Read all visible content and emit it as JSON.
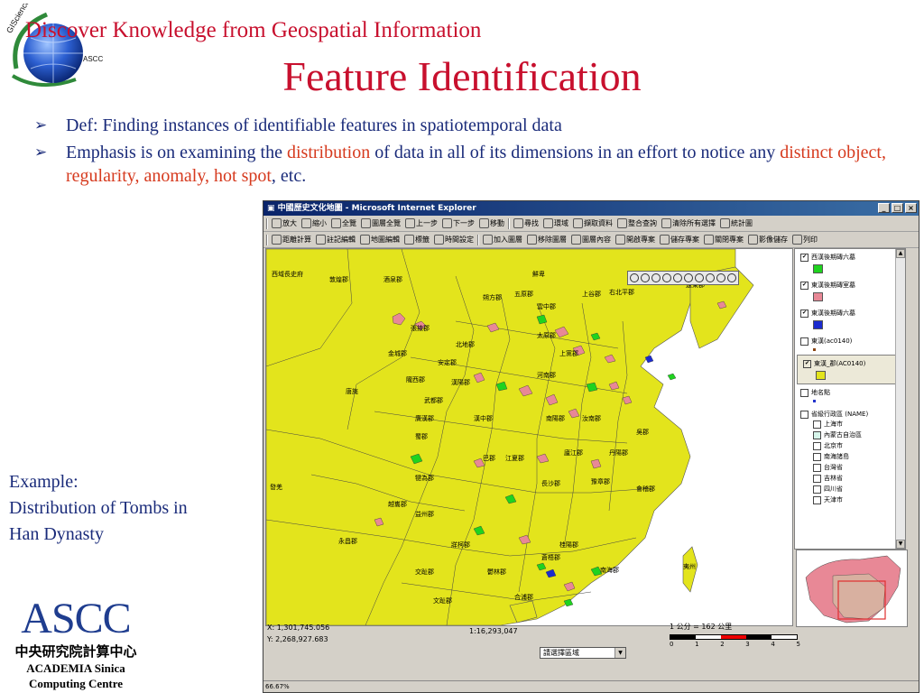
{
  "slide": {
    "tagline": "Discover Knowledge from Geospatial Information",
    "title": "Feature Identification",
    "bullets": {
      "b1_text": "Def: Finding instances of identifiable features in spatiotemporal data",
      "b2_part1": "Emphasis is on examining the ",
      "b2_hl1": "distribution",
      "b2_part2": " of data in all of its dimensions in an effort to notice any ",
      "b2_hl2": "distinct object, regularity, anomaly, hot spot",
      "b2_part3": ", etc."
    },
    "example": {
      "line1": "Example:",
      "line2": "Distribution of Tombs in",
      "line3": "Han Dynasty"
    },
    "logo_text": {
      "top": "GIScience Team",
      "side": "ASCC"
    },
    "ascc": {
      "big": "ASCC",
      "cn": "中央研究院計算中心",
      "en1": "ACADEMIA  Sinica",
      "en2": "Computing  Centre"
    },
    "colors": {
      "accent": "#c8102e",
      "body_text": "#1a2b7a",
      "highlight": "#d63a1e",
      "map_fill": "#e3e41c"
    }
  },
  "browser": {
    "title": "中國歷史文化地圖 - Microsoft Internet Explorer",
    "window_buttons": [
      "_",
      "□",
      "×"
    ],
    "toolbar1": [
      "放大",
      "縮小",
      "全覽",
      "圖層全覽",
      "上一步",
      "下一步",
      "移動",
      "尋找",
      "環域",
      "擷取資料",
      "整合查詢",
      "清除所有選擇",
      "統計圖"
    ],
    "toolbar2": [
      "距離計算",
      "註記編輯",
      "地圖編輯",
      "標籤",
      "時間設定",
      "加入圖層",
      "移除圖層",
      "圖層內容",
      "開啟專案",
      "儲存專案",
      "關閉專案",
      "影像儲存",
      "列印"
    ],
    "map_labels": {
      "west1": "西域長史府",
      "dunhuang": "敦煌郡",
      "jiuquan": "酒泉郡",
      "xianbei": "鮮卑",
      "shuofang": "朔方郡",
      "wuyuan": "五原郡",
      "yunzhong": "雲中郡",
      "shanggu": "上谷郡",
      "youbeiping": "右北平郡",
      "liaodong": "遼東郡",
      "zhangye": "張掖郡",
      "beidi": "北地郡",
      "taiyuan": "太原郡",
      "shangdang": "上黨郡",
      "jincheng": "金城郡",
      "anding": "安定郡",
      "longxi": "隴西郡",
      "hanyang": "漢陽郡",
      "henan": "河南郡",
      "qiang": "唐旄",
      "wudu": "武都郡",
      "guanghan": "廣漢郡",
      "hanzhong": "漢中郡",
      "nanyang": "南陽郡",
      "runan": "汝南郡",
      "shu": "蜀郡",
      "ba": "巴郡",
      "jiangxia": "江夏郡",
      "lujiang": "廬江郡",
      "danyang": "丹陽郡",
      "kuaiji": "會稽郡",
      "wu": "吳郡",
      "fa": "發羌",
      "yuesui": "越巂郡",
      "jianwei": "犍為郡",
      "changsha": "長沙郡",
      "yuzhang": "豫章郡",
      "yizhou": "益州郡",
      "yongchang": "永昌郡",
      "zangke": "牂柯郡",
      "guiyang": "桂陽郡",
      "nanhai": "南海郡",
      "yulin": "鬱林郡",
      "cangwu": "蒼梧郡",
      "hepu": "合浦郡",
      "jiaozhi": "交趾郡",
      "wenzhi": "文趾郡",
      "yizhou2": "夷州"
    },
    "legend": {
      "items": [
        {
          "label": "西漢後期磚六墓",
          "checked": true,
          "color": "#1fd31f"
        },
        {
          "label": "東漢後期磚室墓",
          "checked": true,
          "color": "#e88896"
        },
        {
          "label": "東漢後期磚六墓",
          "checked": true,
          "color": "#1b2bcf"
        },
        {
          "label": "東漢(ac0140)",
          "checked": false,
          "color": "#8b4513"
        },
        {
          "label": "東漢_郡(AC0140)",
          "checked": true,
          "color": "#e3e41c"
        },
        {
          "label": "地名點",
          "checked": false,
          "color": "#2233cc"
        },
        {
          "label": "省級行政區 (NAME)",
          "checked": false,
          "color": "#ffffff"
        }
      ],
      "provinces": [
        "上海市",
        "內蒙古自治區",
        "北京市",
        "南海諸島",
        "台灣省",
        "吉林省",
        "四川省",
        "天津市"
      ]
    },
    "status": {
      "x": "X: 1,301,745.056",
      "y": "Y: 2,268,927.683",
      "scale": "1:16,293,047",
      "unit": "1 公分 = 162 公里",
      "ticks": [
        "0",
        "1",
        "2",
        "3",
        "4",
        "5"
      ],
      "select_placeholder": "請選擇區域",
      "strip": "66.67%"
    }
  }
}
